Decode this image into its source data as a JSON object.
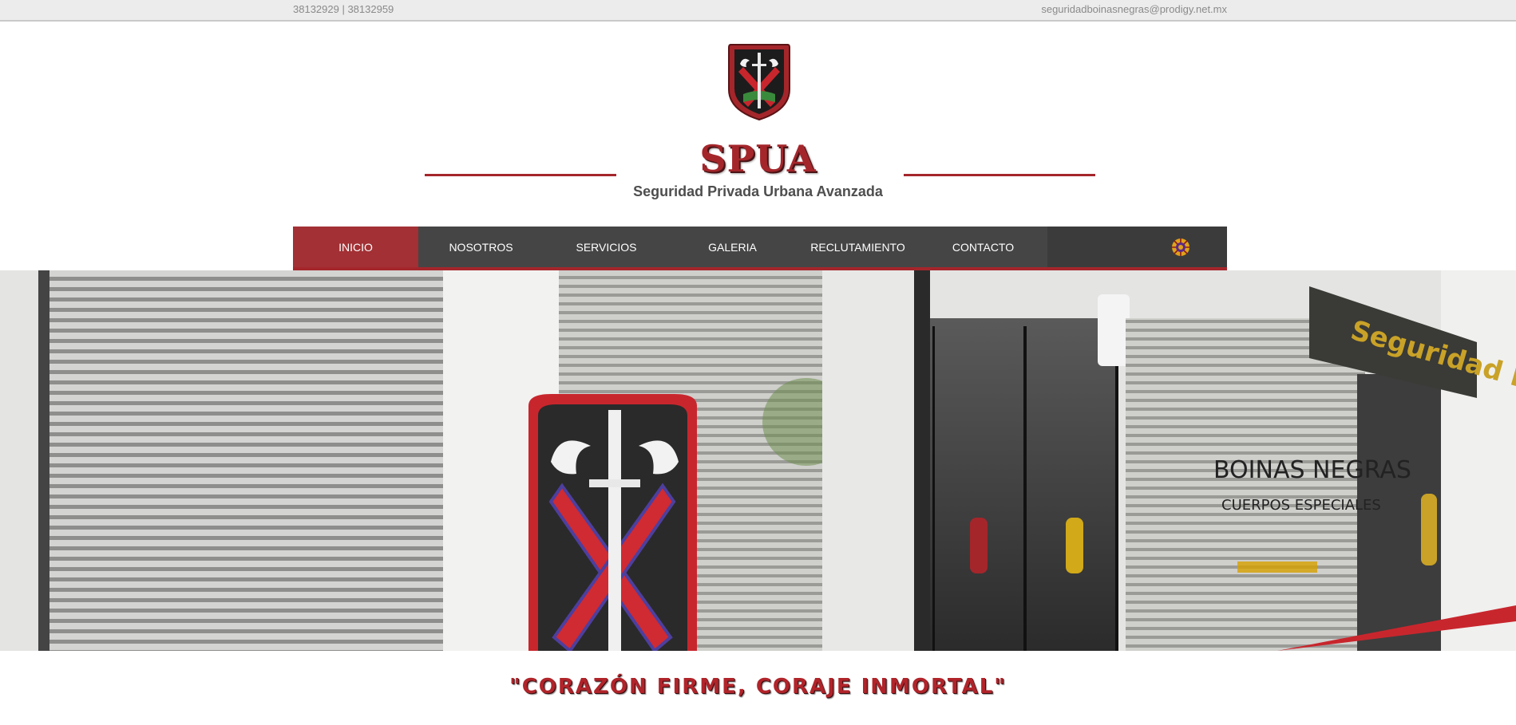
{
  "topbar": {
    "phones": "38132929 | 38132959",
    "email": "seguridadboinasnegras@prodigy.net.mx"
  },
  "header": {
    "title": "SPUA",
    "subtitle": "Seguridad Privada Urbana Avanzada",
    "logo_icon": "crest-sword-shield-icon"
  },
  "nav": {
    "items": [
      {
        "label": "INICIO",
        "active": true
      },
      {
        "label": "NOSOTROS",
        "active": false
      },
      {
        "label": "SERVICIOS",
        "active": false
      },
      {
        "label": "GALERIA",
        "active": false
      },
      {
        "label": "RECLUTAMIENTO",
        "active": false
      },
      {
        "label": "CONTACTO",
        "active": false
      }
    ],
    "badge_icon": "sun-emblem-icon"
  },
  "hero": {
    "storefront_sign": "Seguridad Privada",
    "window_text_1": "BOINAS NEGRAS",
    "window_text_2": "CUERPOS ESPECIALES"
  },
  "motto": "\"CORAZÓN FIRME, CORAJE INMORTAL\"",
  "colors": {
    "brand_red": "#a4262b",
    "nav_bg": "#454545",
    "topbar_bg": "#ececec"
  }
}
